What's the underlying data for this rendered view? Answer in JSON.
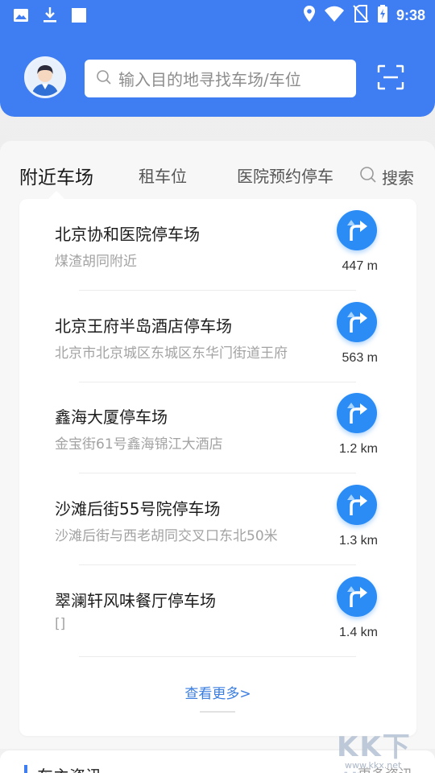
{
  "status_bar": {
    "time": "9:38",
    "left_icons": [
      "image-icon",
      "download-icon",
      "square-icon"
    ],
    "right_icons": [
      "location-icon",
      "wifi-icon",
      "no-sim-icon",
      "battery-charging-icon"
    ]
  },
  "header": {
    "search_placeholder": "输入目的地寻找车场/车位",
    "avatar_icon": "user-avatar-icon",
    "scan_icon": "scan-icon"
  },
  "tabs": [
    {
      "label": "附近车场",
      "active": true
    },
    {
      "label": "租车位",
      "active": false
    },
    {
      "label": "医院预约停车",
      "active": false
    }
  ],
  "tab_search_label": "搜索",
  "parking_list": [
    {
      "name": "北京协和医院停车场",
      "address": "煤渣胡同附近",
      "distance": "447 m"
    },
    {
      "name": "北京王府半岛酒店停车场",
      "address": "北京市北京城区东城区东华门街道王府",
      "distance": "563 m"
    },
    {
      "name": "鑫海大厦停车场",
      "address": "金宝街61号鑫海锦江大酒店",
      "distance": "1.2 km"
    },
    {
      "name": "沙滩后街55号院停车场",
      "address": "沙滩后街与西老胡同交叉口东北50米",
      "distance": "1.3 km"
    },
    {
      "name": "翠澜轩风味餐厅停车场",
      "address": "[]",
      "distance": "1.4 km"
    }
  ],
  "more_label": "查看更多>",
  "bottom_section": {
    "title": "车主资讯",
    "right_label": "更多资讯"
  },
  "watermark": {
    "text": "KK下载",
    "url": "www.kkx.net"
  },
  "colors": {
    "primary": "#3f7ef2",
    "nav_button": "#2b8cf6",
    "link": "#3a7de0"
  }
}
